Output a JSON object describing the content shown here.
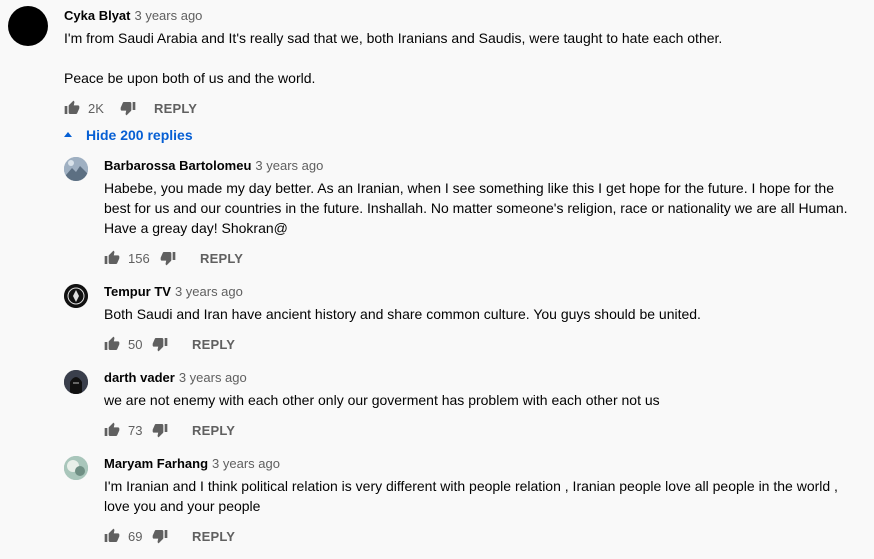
{
  "top_comment": {
    "author": "Cyka Blyat",
    "time": "3 years ago",
    "text_line1": "I'm from Saudi Arabia and It's really sad that we, both Iranians and Saudis, were taught to hate each other.",
    "text_line2": "Peace be upon both of us and the world.",
    "likes": "2K",
    "reply_label": "REPLY"
  },
  "replies_toggle": {
    "label": "Hide 200 replies",
    "icon": "caret-up-icon"
  },
  "replies": [
    {
      "author": "Barbarossa Bartolomeu",
      "time": "3 years ago",
      "text": "Habebe, you made my day better. As an Iranian, when I see something like this I get hope for the future. I hope for the best for us and our countries in the future. Inshallah. No matter someone's religion, race or nationality we are all Human. Have a greay day! Shokran@",
      "likes": "156",
      "reply_label": "REPLY"
    },
    {
      "author": "Tempur TV",
      "time": "3 years ago",
      "text": "Both Saudi and Iran have ancient history and share common culture.  You guys should be united.",
      "likes": "50",
      "reply_label": "REPLY"
    },
    {
      "author": "darth vader",
      "time": "3 years ago",
      "text": "we are not enemy with each other only our goverment has problem with each other not us",
      "likes": "73",
      "reply_label": "REPLY"
    },
    {
      "author": "Maryam Farhang",
      "time": "3 years ago",
      "text": "I'm Iranian and I think political relation is very different with people relation , Iranian people love all people in the world , love you and your people",
      "likes": "69",
      "reply_label": "REPLY"
    }
  ]
}
